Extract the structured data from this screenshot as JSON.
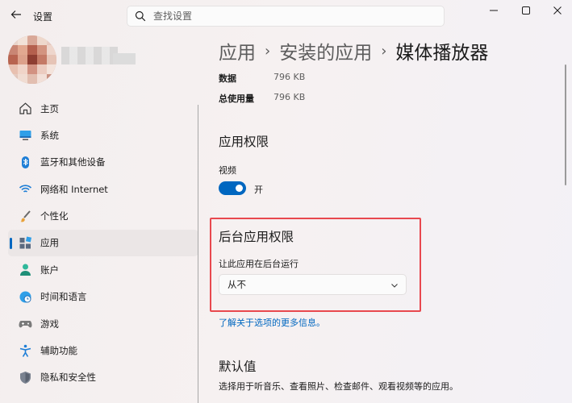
{
  "app": {
    "title": "设置"
  },
  "search": {
    "placeholder": "查找设置"
  },
  "sidebar": {
    "items": [
      {
        "label": "主页",
        "icon": "home-icon"
      },
      {
        "label": "系统",
        "icon": "system-icon"
      },
      {
        "label": "蓝牙和其他设备",
        "icon": "bluetooth-icon"
      },
      {
        "label": "网络和 Internet",
        "icon": "wifi-icon"
      },
      {
        "label": "个性化",
        "icon": "brush-icon"
      },
      {
        "label": "应用",
        "icon": "apps-icon",
        "active": true
      },
      {
        "label": "账户",
        "icon": "account-icon"
      },
      {
        "label": "时间和语言",
        "icon": "clock-globe-icon"
      },
      {
        "label": "游戏",
        "icon": "gamepad-icon"
      },
      {
        "label": "辅助功能",
        "icon": "accessibility-icon"
      },
      {
        "label": "隐私和安全性",
        "icon": "shield-icon"
      }
    ]
  },
  "breadcrumb": {
    "items": [
      "应用",
      "安装的应用",
      "媒体播放器"
    ]
  },
  "info": [
    {
      "key": "数据",
      "value": "796 KB"
    },
    {
      "key": "总使用量",
      "value": "796 KB"
    }
  ],
  "permissions": {
    "title": "应用权限",
    "video_label": "视频",
    "video_state": "开",
    "video_on": true
  },
  "background": {
    "title": "后台应用权限",
    "label": "让此应用在后台运行",
    "selected": "从不",
    "link": "了解关于选项的更多信息。"
  },
  "defaults": {
    "title": "默认值",
    "description": "选择用于听音乐、查看照片、检查邮件、观看视频等的应用。"
  },
  "colors": {
    "accent": "#0067c0",
    "highlight": "#e8484e"
  }
}
